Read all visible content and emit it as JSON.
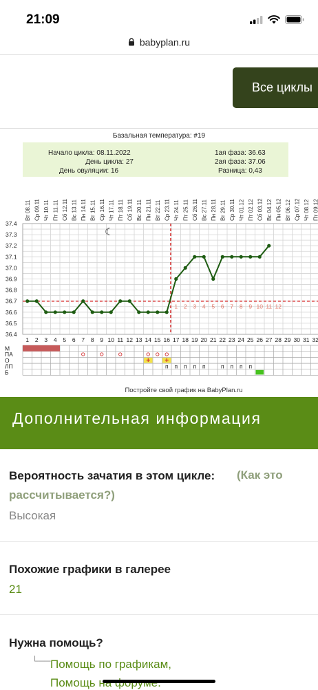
{
  "status": {
    "time": "21:09"
  },
  "browser": {
    "domain": "babyplan.ru"
  },
  "header": {
    "all_cycles_label": "Все циклы"
  },
  "chart_data": {
    "type": "line",
    "title": "Базальная температура: #19",
    "info": {
      "cycle_start": "Начало цикла: 08.11.2022",
      "cycle_day": "День цикла: 27",
      "ovulation_day": "День овуляции: 16",
      "phase1": "1ая фаза: 36.63",
      "phase2": "2ая фаза: 37.06",
      "difference": "Разница: 0,43"
    },
    "dates": [
      "Вт 08.11",
      "Ср 09.11",
      "Чт 10.11",
      "Пт 11.11",
      "Сб 12.11",
      "Вс 13.11",
      "Пн 14.11",
      "Вт 15.11",
      "Ср 16.11",
      "Чт 17.11",
      "Пт 18.11",
      "Сб 19.11",
      "Вс 20.11",
      "Пн 21.11",
      "Вт 22.11",
      "Ср 23.11",
      "Чт 24.11",
      "Пт 25.11",
      "Сб 26.11",
      "Вс 27.11",
      "Пн 28.11",
      "Вт 29.11",
      "Ср 30.11",
      "Чт 01.12",
      "Пт 02.12",
      "Сб 03.12",
      "Вс 04.12",
      "Пн 05.12",
      "Вт 06.12",
      "Ср 07.12",
      "Чт 08.12",
      "Пт 09.12"
    ],
    "days": [
      1,
      2,
      3,
      4,
      5,
      6,
      7,
      8,
      9,
      10,
      11,
      12,
      13,
      14,
      15,
      16,
      17,
      18,
      19,
      20,
      21,
      22,
      23,
      24,
      25,
      26,
      27,
      28,
      29,
      30,
      31,
      32
    ],
    "y_ticks": [
      "37.4",
      "37.3",
      "37.2",
      "37.1",
      "37.0",
      "36.9",
      "36.8",
      "36.7",
      "36.6",
      "36.5",
      "36.4"
    ],
    "ylim": [
      36.4,
      37.4
    ],
    "temperatures": [
      36.7,
      36.7,
      36.6,
      36.6,
      36.6,
      36.6,
      36.7,
      36.6,
      36.6,
      36.6,
      36.7,
      36.7,
      36.6,
      36.6,
      36.6,
      36.6,
      36.9,
      37.0,
      37.1,
      37.1,
      36.9,
      37.1,
      37.1,
      37.1,
      37.1,
      37.1,
      37.2
    ],
    "coverline": 36.7,
    "ovulation_day_index": 16,
    "luteal_day_labels": [
      "1",
      "2",
      "3",
      "4",
      "5",
      "6",
      "7",
      "8",
      "9",
      "10",
      "11",
      "12"
    ],
    "row_labels": [
      "М",
      "ПА",
      "О",
      "ЛП",
      "Б"
    ],
    "menstruation_days": [
      1,
      2,
      3,
      4
    ],
    "pa_circle_days": [
      7,
      9,
      11,
      14,
      15,
      16
    ],
    "o_plus_days": [
      14,
      16
    ],
    "lp_p_days": [
      16,
      17,
      18,
      19,
      20,
      22,
      23,
      24,
      25
    ],
    "b_green_days": [
      26
    ],
    "footer": "Постройте свой график на BabyPlan.ru"
  },
  "additional": {
    "banner_title": "Дополнительная информация",
    "conception_label": "Вероятность зачатия в этом цикле:",
    "conception_link": "(Как это рассчитывается?)",
    "conception_value": "Высокая",
    "similar_label": "Похожие графики в галерее",
    "similar_value": "21",
    "help_label": "Нужна помощь?",
    "help_link1": "Помощь по графикам,",
    "help_link2": "Помощь на форуме."
  }
}
